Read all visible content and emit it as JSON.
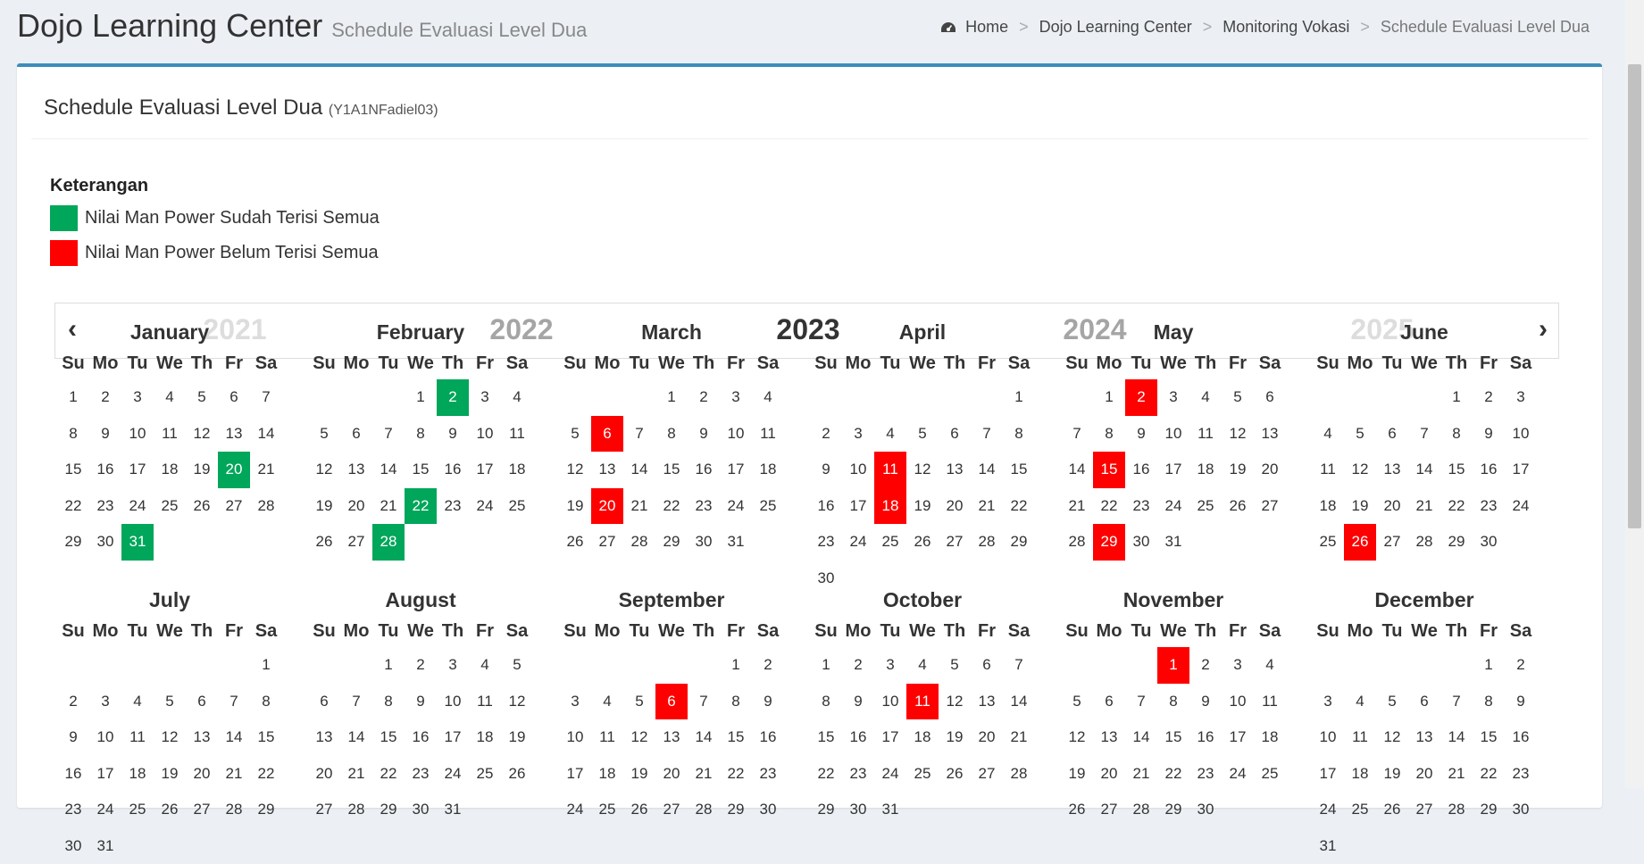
{
  "header": {
    "title": "Dojo Learning Center",
    "subtitle": "Schedule Evaluasi Level Dua",
    "breadcrumb": [
      "Home",
      "Dojo Learning Center",
      "Monitoring Vokasi",
      "Schedule Evaluasi Level Dua"
    ],
    "breadcrumb_separator": ">"
  },
  "box": {
    "title": "Schedule Evaluasi Level Dua",
    "code": "(Y1A1NFadiel03)"
  },
  "legend": {
    "title": "Keterangan",
    "items": [
      {
        "label": "Nilai Man Power Sudah Terisi Semua",
        "color": "#00a65a"
      },
      {
        "label": "Nilai Man Power Belum Terisi Semua",
        "color": "#ff0000"
      }
    ]
  },
  "year_nav": {
    "prev": "‹",
    "next": "›",
    "years": [
      "2021",
      "2022",
      "2023",
      "2024",
      "2025"
    ],
    "selected": "2023"
  },
  "weekdays": [
    "Su",
    "Mo",
    "Tu",
    "We",
    "Th",
    "Fr",
    "Sa"
  ],
  "colors": {
    "green": "#00a65a",
    "red": "#ff0000",
    "accent": "#3c8dbc"
  },
  "calendar": {
    "year": 2023,
    "months": [
      {
        "name": "January",
        "highlights": [
          {
            "day": 20,
            "status": "green"
          },
          {
            "day": 31,
            "status": "green"
          }
        ]
      },
      {
        "name": "February",
        "highlights": [
          {
            "day": 2,
            "status": "green"
          },
          {
            "day": 22,
            "status": "green"
          },
          {
            "day": 28,
            "status": "green"
          }
        ]
      },
      {
        "name": "March",
        "highlights": [
          {
            "day": 6,
            "status": "red"
          },
          {
            "day": 20,
            "status": "red"
          }
        ]
      },
      {
        "name": "April",
        "highlights": [
          {
            "day": 11,
            "status": "red"
          },
          {
            "day": 18,
            "status": "red"
          }
        ]
      },
      {
        "name": "May",
        "highlights": [
          {
            "day": 2,
            "status": "red"
          },
          {
            "day": 15,
            "status": "red"
          },
          {
            "day": 29,
            "status": "red"
          }
        ]
      },
      {
        "name": "June",
        "highlights": [
          {
            "day": 26,
            "status": "red"
          }
        ]
      },
      {
        "name": "July",
        "highlights": []
      },
      {
        "name": "August",
        "highlights": []
      },
      {
        "name": "September",
        "highlights": [
          {
            "day": 6,
            "status": "red"
          }
        ]
      },
      {
        "name": "October",
        "highlights": [
          {
            "day": 11,
            "status": "red"
          }
        ]
      },
      {
        "name": "November",
        "highlights": [
          {
            "day": 1,
            "status": "red"
          }
        ]
      },
      {
        "name": "December",
        "highlights": []
      }
    ]
  }
}
